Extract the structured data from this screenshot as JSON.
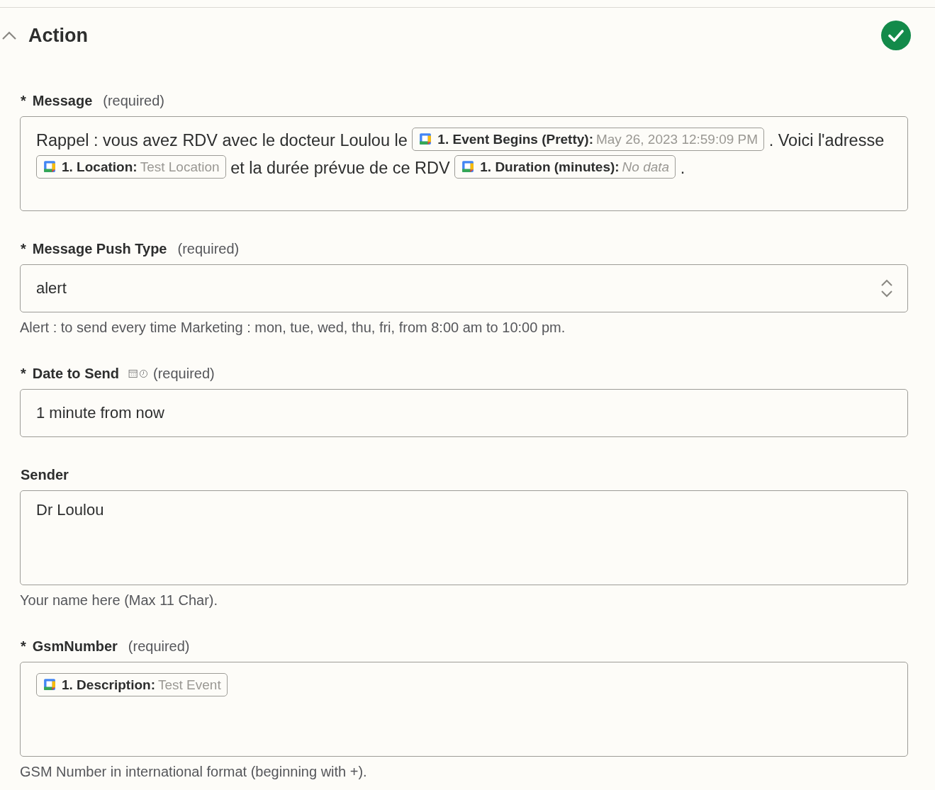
{
  "section": {
    "title": "Action",
    "expanded": true,
    "complete": true
  },
  "fields": [
    {
      "kind": "mapped",
      "label": "Message",
      "asterisk": "*",
      "note": "(required)",
      "parts": [
        {
          "kind": "text",
          "text": "Rappel : vous avez RDV avec le docteur Loulou le"
        },
        {
          "kind": "pill",
          "label": "1. Event Begins (Pretty):",
          "value": "May 26, 2023 12:59:09 PM",
          "missing": false
        },
        {
          "kind": "text",
          "text": ". Voici"
        },
        {
          "kind": "text",
          "text": "l'adresse"
        },
        {
          "kind": "pill",
          "label": "1. Location:",
          "value": "Test Location",
          "missing": false
        },
        {
          "kind": "text",
          "text": "et la durée prévue de ce RDV"
        },
        {
          "kind": "pill",
          "label": "1. Duration (minutes):",
          "value": "No data",
          "missing": true
        },
        {
          "kind": "text",
          "text": "."
        }
      ]
    },
    {
      "kind": "select",
      "label": "Message Push Type",
      "asterisk": "*",
      "note": "(required)",
      "value": "alert",
      "help": "Alert : to send every time Marketing : mon, tue, wed, thu, fri, from 8:00 am to 10:00 pm."
    },
    {
      "kind": "text",
      "label": "Date to Send",
      "asterisk": "*",
      "note": "(required)",
      "datetime_icons": true,
      "value": "1 minute from now"
    },
    {
      "kind": "textarea",
      "label": "Sender",
      "value": "Dr Loulou",
      "help": "Your name here (Max 11 Char)."
    },
    {
      "kind": "mapped",
      "label": "GsmNumber",
      "asterisk": "*",
      "note": "(required)",
      "parts": [
        {
          "kind": "pill",
          "label": "1. Description:",
          "value": "Test Event",
          "missing": false
        }
      ],
      "help": "GSM Number in international format (beginning with +)."
    }
  ]
}
